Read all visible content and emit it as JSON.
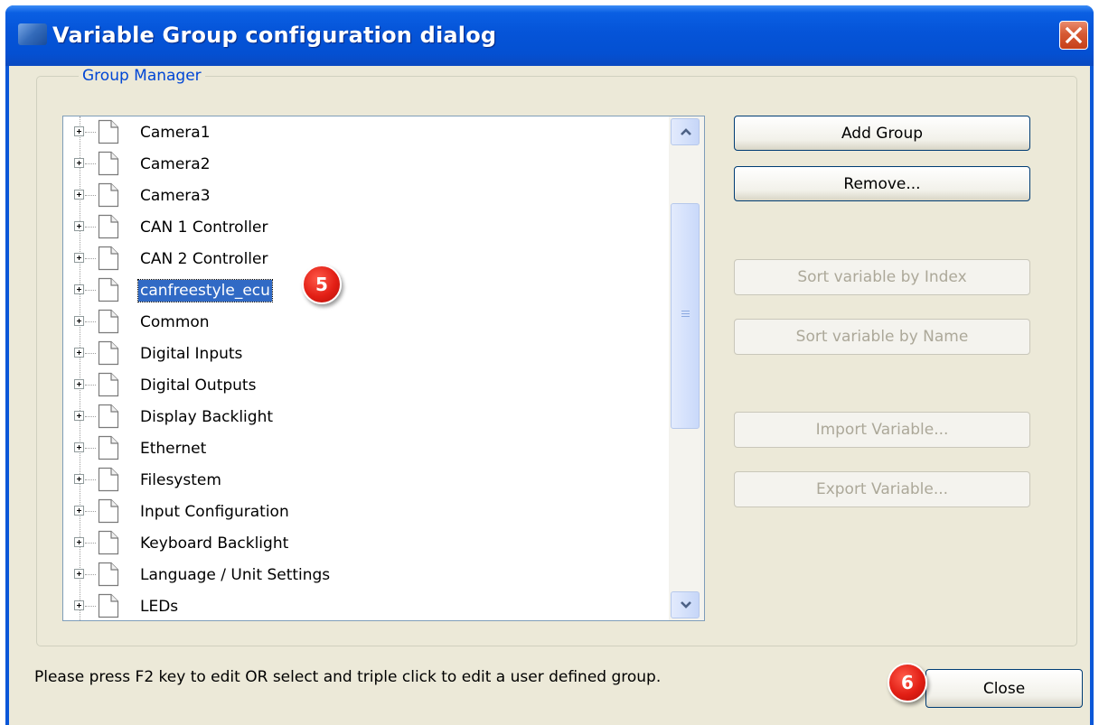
{
  "window": {
    "title": "Variable Group configuration dialog"
  },
  "group_box": {
    "legend": "Group Manager"
  },
  "tree": {
    "items": [
      {
        "label": "Camera1",
        "selected": false
      },
      {
        "label": "Camera2",
        "selected": false
      },
      {
        "label": "Camera3",
        "selected": false
      },
      {
        "label": "CAN 1 Controller",
        "selected": false
      },
      {
        "label": "CAN 2 Controller",
        "selected": false
      },
      {
        "label": "canfreestyle_ecu",
        "selected": true
      },
      {
        "label": "Common",
        "selected": false
      },
      {
        "label": "Digital Inputs",
        "selected": false
      },
      {
        "label": "Digital Outputs",
        "selected": false
      },
      {
        "label": "Display Backlight",
        "selected": false
      },
      {
        "label": "Ethernet",
        "selected": false
      },
      {
        "label": "Filesystem",
        "selected": false
      },
      {
        "label": "Input Configuration",
        "selected": false
      },
      {
        "label": "Keyboard Backlight",
        "selected": false
      },
      {
        "label": "Language / Unit Settings",
        "selected": false
      },
      {
        "label": "LEDs",
        "selected": false
      }
    ]
  },
  "buttons": {
    "add_group": "Add Group",
    "remove": "Remove...",
    "sort_by_index": "Sort variable by Index",
    "sort_by_name": "Sort variable by Name",
    "import_variable": "Import Variable...",
    "export_variable": "Export Variable...",
    "close": "Close"
  },
  "status_text": "Please press F2 key to edit OR select and triple click to edit a user defined group.",
  "annotations": {
    "badge_5": "5",
    "badge_6": "6"
  },
  "icons": {
    "title_close": "close-icon",
    "tree_expander": "plus-icon",
    "tree_node": "document-icon",
    "scroll_up": "chevron-up-icon",
    "scroll_down": "chevron-down-icon"
  },
  "colors": {
    "titlebar": "#0554d8",
    "dialog_bg": "#ece9d8",
    "selection": "#316ac5",
    "badge": "#e21f15",
    "legend_text": "#0046d5"
  }
}
